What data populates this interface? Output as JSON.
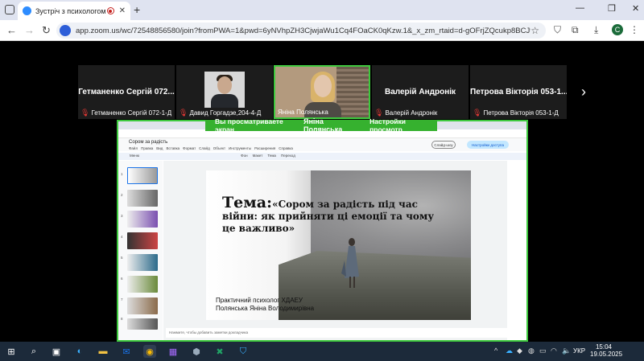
{
  "browser": {
    "tab_title": "Зустріч з психологом",
    "new_tab": "+",
    "close_tab": "✕",
    "url": "app.zoom.us/wc/72548856580/join?fromPWA=1&pwd=6yNVhpZH3CjwjaWu1Cq4FOaCK0qKzw.1&_x_zm_rtaid=d-gOFrjZQcukp8BCJ9Ky7A.17476541550...",
    "profile_initial": "C"
  },
  "zoom": {
    "participants": [
      {
        "big": "Гетманенко Сергій 072...",
        "name": "Гетманенко Сергій 072-1-Д"
      },
      {
        "big": "",
        "name": "Давид Горгадзе,204-4-Д"
      },
      {
        "big": "",
        "name": "Яніна Полянська"
      },
      {
        "big": "Валерій Андронік",
        "name": "Валерій Андронік"
      },
      {
        "big": "Петрова Вікторія 053-1...",
        "name": "Петрова Вікторія 053-1-Д"
      }
    ],
    "next_arrow": "›",
    "share_banner": {
      "text": "Вы просматриваете экран",
      "presenter": "Яніна Полянська",
      "settings": "Настройки просмотр"
    }
  },
  "slides": {
    "doc_title": "Сором за радість",
    "menu": [
      "Файл",
      "Правка",
      "Вид",
      "Вставка",
      "Формат",
      "Слайд",
      "Объект",
      "Инструменты",
      "Расширения",
      "Справка"
    ],
    "toolbar": [
      "Меню",
      "Фон",
      "Макет",
      "Тема",
      "Переход"
    ],
    "slideshow_btn": "Слайд-шоу",
    "access_btn": "Настройки доступа",
    "thumb_numbers": [
      "1",
      "2",
      "3",
      "4",
      "5",
      "6",
      "7",
      "8"
    ],
    "notes_placeholder": "Нажмите, чтобы добавить заметки докладчика",
    "slide": {
      "tema": "Тема:",
      "title_rest": "«Сором за радість під час війни: як прийняти ці емоції та чому це важливо»",
      "author_line1": "Практичний психолог ХДАЕУ",
      "author_line2": "Полянська Яніна Володимирівна"
    }
  },
  "taskbar": {
    "lang": "УКР",
    "time": "15:04",
    "date": "19.05.2025"
  }
}
